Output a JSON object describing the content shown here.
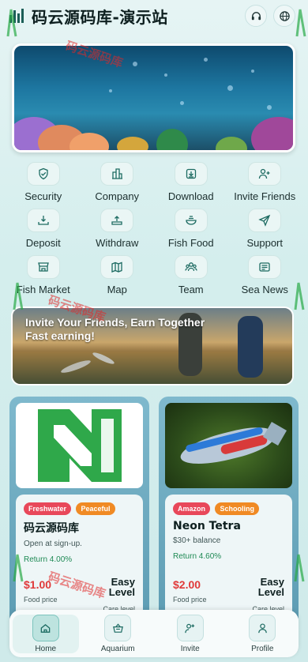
{
  "header": {
    "title": "码云源码库-演示站",
    "icons": [
      "headset-icon",
      "globe-icon"
    ]
  },
  "menu": [
    {
      "label": "Security",
      "icon": "shield-check-icon"
    },
    {
      "label": "Company",
      "icon": "building-icon"
    },
    {
      "label": "Download",
      "icon": "download-box-icon"
    },
    {
      "label": "Invite Friends",
      "icon": "user-plus-icon"
    },
    {
      "label": "Deposit",
      "icon": "tray-in-icon"
    },
    {
      "label": "Withdraw",
      "icon": "tray-out-icon"
    },
    {
      "label": "Fish Food",
      "icon": "bowl-icon"
    },
    {
      "label": "Support",
      "icon": "paper-plane-icon"
    },
    {
      "label": "Fish Market",
      "icon": "store-icon"
    },
    {
      "label": "Map",
      "icon": "map-icon"
    },
    {
      "label": "Team",
      "icon": "team-icon"
    },
    {
      "label": "Sea News",
      "icon": "newspaper-icon"
    }
  ],
  "banner": {
    "line1": "Invite Your Friends, Earn Together",
    "line2": "Fast earning!"
  },
  "cards": [
    {
      "tags": [
        "Freshwater",
        "Peaceful"
      ],
      "tag_colors": [
        "#e8485a",
        "#f08a24"
      ],
      "name": "码云源码库",
      "sub": "Open at sign-up.",
      "return": "Return 4.00%",
      "price": "$1.00",
      "price_label": "Food price",
      "level": "Easy Level",
      "level_label": "Care level"
    },
    {
      "tags": [
        "Amazon",
        "Schooling"
      ],
      "tag_colors": [
        "#e8485a",
        "#f08a24"
      ],
      "name": "Neon Tetra",
      "sub": "$30+ balance",
      "return": "Return 4.60%",
      "price": "$2.00",
      "price_label": "Food price",
      "level": "Easy Level",
      "level_label": "Care level"
    }
  ],
  "nav": [
    {
      "label": "Home",
      "icon": "home-icon",
      "active": true
    },
    {
      "label": "Aquarium",
      "icon": "basket-icon",
      "active": false
    },
    {
      "label": "Invite",
      "icon": "user-add-icon",
      "active": false
    },
    {
      "label": "Profile",
      "icon": "person-icon",
      "active": false
    }
  ],
  "watermark": "码云源码库"
}
